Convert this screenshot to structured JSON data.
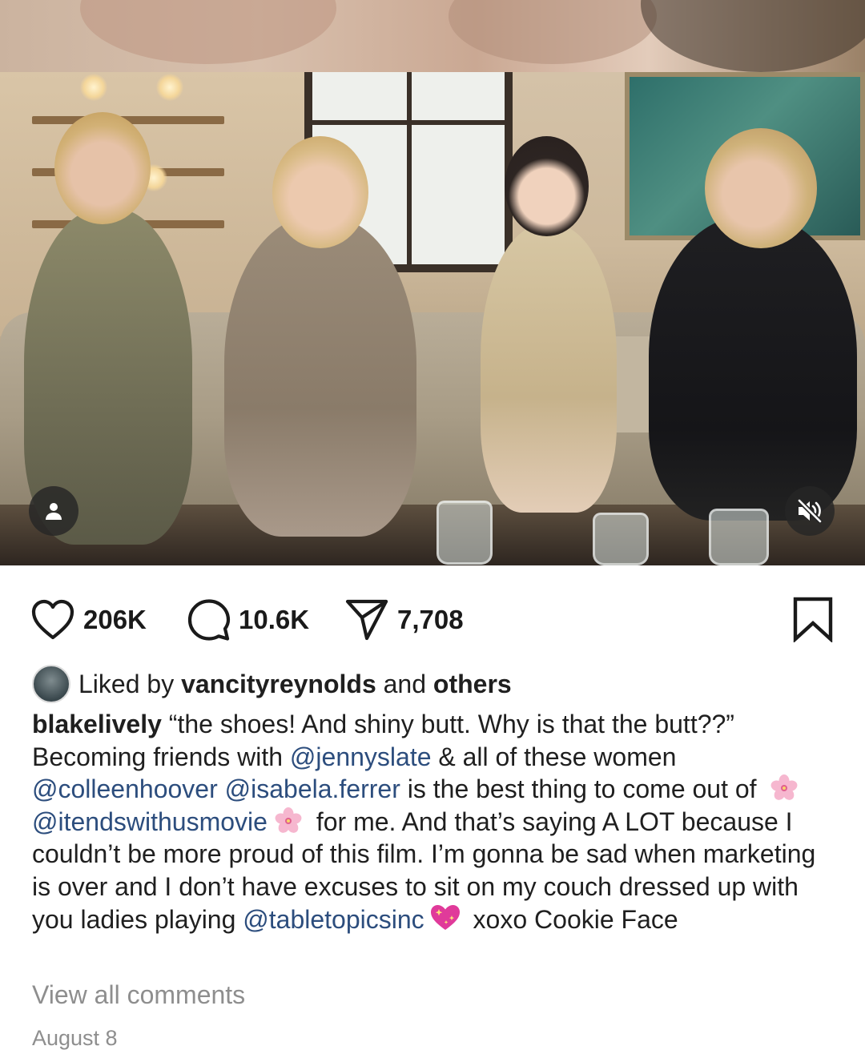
{
  "post": {
    "actions": {
      "likes": "206K",
      "comments": "10.6K",
      "shares": "7,708"
    },
    "liked_by": {
      "prefix": "Liked by ",
      "user": "vancityreynolds",
      "middle": " and ",
      "others": "others"
    },
    "caption": {
      "username": "blakelively",
      "t1": " “the shoes! And shiny butt. Why is that the butt??” Becoming friends with ",
      "m1": "@jennyslate",
      "t2": " & all of these women ",
      "m2": "@colleenhoover",
      "t3": " ",
      "m3": "@isabela.ferrer",
      "t4": " is the best thing to come out of ",
      "m4": "@itendswithusmovie",
      "t5": " for me. And that’s saying A LOT because I couldn’t be more proud of this film. I’m gonna be sad when marketing is over and I don’t have excuses to sit on my couch dressed up with you ladies playing ",
      "m5": "@tabletopicsinc",
      "t6": " xoxo Cookie Face",
      "emoji_flower": "cherry-blossom-icon",
      "emoji_heart": "sparkling-heart-icon"
    },
    "view_all_comments": "View all comments",
    "date": "August 8"
  },
  "colors": {
    "mention": "#2c4d7d",
    "muted": "#8e8e8e",
    "text": "#1f1f1f"
  }
}
